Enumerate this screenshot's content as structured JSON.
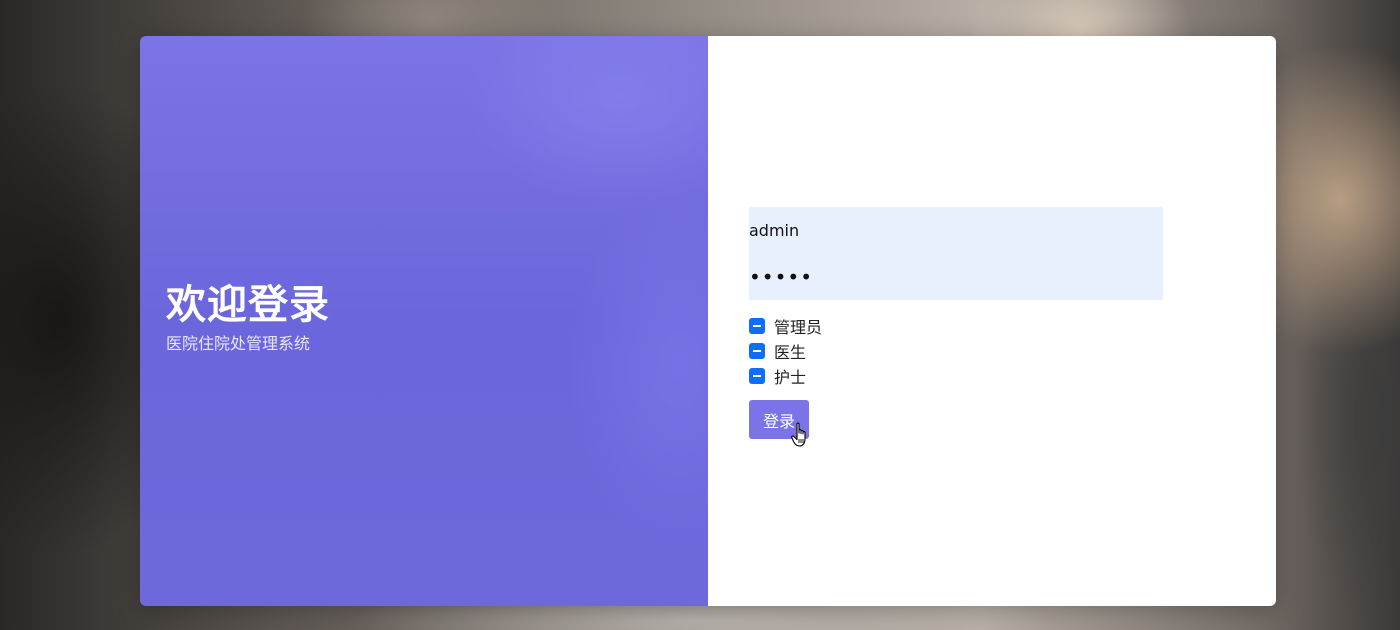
{
  "login_panel": {
    "title": "欢迎登录",
    "subtitle": "医院住院处管理系统"
  },
  "form": {
    "username_value": "admin",
    "password_value": "•••••",
    "roles": [
      {
        "label": "管理员",
        "state": "indeterminate"
      },
      {
        "label": "医生",
        "state": "indeterminate"
      },
      {
        "label": "护士",
        "state": "indeterminate"
      }
    ],
    "login_button_label": "登录"
  },
  "colors": {
    "accent": "#7b74e9",
    "panel": "#6c66dc",
    "input_autofill": "#e8f0fe",
    "checkbox": "#0d6efd"
  },
  "icons": {
    "cursor": "hand-pointer-icon"
  }
}
